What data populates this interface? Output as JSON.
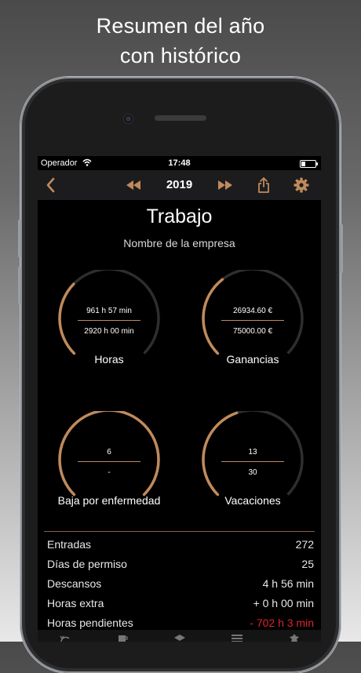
{
  "headline": {
    "line1": "Resumen del año",
    "line2": "con histórico"
  },
  "status_bar": {
    "carrier": "Operador",
    "time": "17:48"
  },
  "nav": {
    "year": "2019"
  },
  "header": {
    "title": "Trabajo",
    "company": "Nombre de la empresa"
  },
  "gauges": [
    {
      "label": "Horas",
      "value": "961 h 57 min",
      "total": "2920 h 00 min",
      "fraction": 0.33
    },
    {
      "label": "Ganancias",
      "value": "26934.60 €",
      "total": "75000.00 €",
      "fraction": 0.36
    },
    {
      "label": "Baja por enfermedad",
      "value": "6",
      "total": "-",
      "fraction": 1.0
    },
    {
      "label": "Vacaciones",
      "value": "13",
      "total": "30",
      "fraction": 0.43
    }
  ],
  "stats": [
    {
      "label": "Entradas",
      "value": "272"
    },
    {
      "label": "Días de permiso",
      "value": "25"
    },
    {
      "label": "Descansos",
      "value": "4 h 56 min"
    },
    {
      "label": "Horas extra",
      "value": "+ 0 h 00 min"
    },
    {
      "label": "Horas pendientes",
      "value": "- 702 h 3 min"
    }
  ],
  "colors": {
    "accent": "#c08a5b",
    "track": "#2e2e30",
    "negative": "#e0222b",
    "navbar": "#1c1c1e"
  },
  "icons": {
    "back": "chevron-left-icon",
    "prev": "rewind-icon",
    "next": "fast-forward-icon",
    "share": "share-icon",
    "settings": "gear-icon"
  }
}
